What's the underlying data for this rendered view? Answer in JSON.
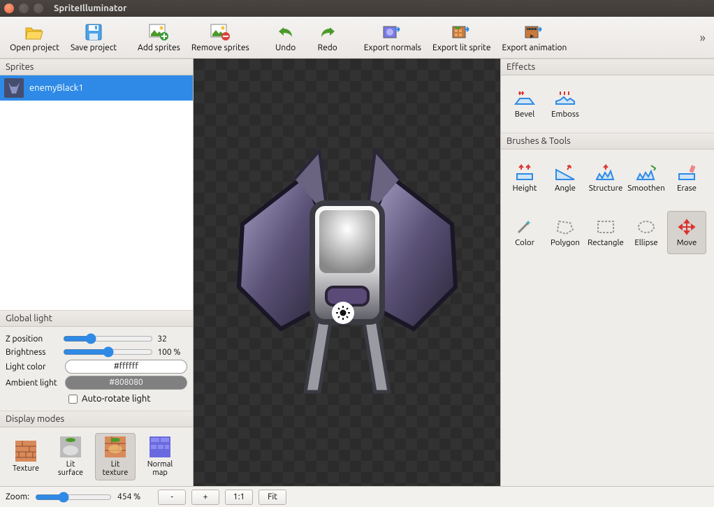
{
  "window": {
    "title": "SpriteIlluminator"
  },
  "toolbar": {
    "open": "Open project",
    "save": "Save project",
    "add": "Add sprites",
    "remove": "Remove sprites",
    "undo": "Undo",
    "redo": "Redo",
    "export_normals": "Export normals",
    "export_lit": "Export lit sprite",
    "export_anim": "Export animation"
  },
  "panels": {
    "sprites": "Sprites",
    "global_light": "Global light",
    "display_modes": "Display modes",
    "effects": "Effects",
    "brushes": "Brushes & Tools"
  },
  "sprites": {
    "items": [
      {
        "name": "enemyBlack1",
        "selected": true
      }
    ]
  },
  "global_light": {
    "zpos_label": "Z position",
    "zpos_value": "32",
    "brightness_label": "Brightness",
    "brightness_value": "100 %",
    "light_color_label": "Light color",
    "light_color_value": "#ffffff",
    "ambient_label": "Ambient light",
    "ambient_value": "#808080",
    "autorotate_label": "Auto-rotate light",
    "autorotate_checked": false
  },
  "display_modes": {
    "texture": "Texture",
    "lit_surface": "Lit\nsurface",
    "lit_texture": "Lit\ntexture",
    "normal_map": "Normal\nmap",
    "selected": "lit_texture"
  },
  "effects": {
    "bevel": "Bevel",
    "emboss": "Emboss"
  },
  "tools": {
    "height": "Height",
    "angle": "Angle",
    "structure": "Structure",
    "smoothen": "Smoothen",
    "erase": "Erase",
    "color": "Color",
    "polygon": "Polygon",
    "rectangle": "Rectangle",
    "ellipse": "Ellipse",
    "move": "Move",
    "selected": "move"
  },
  "status": {
    "zoom_label": "Zoom:",
    "zoom_value": "454 %",
    "minus": "-",
    "plus": "+",
    "oneone": "1:1",
    "fit": "Fit"
  }
}
